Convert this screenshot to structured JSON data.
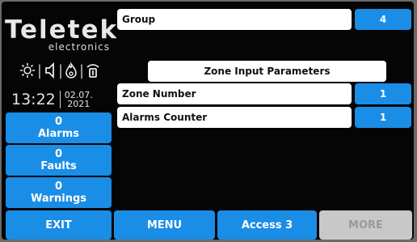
{
  "brand": {
    "name": "Teletek",
    "tagline": "electronics"
  },
  "status_icons": [
    "sun-icon",
    "speaker-icon",
    "flame-icon",
    "wifi-icon"
  ],
  "clock": {
    "time": "13:22",
    "date_day_month": "02.07.",
    "date_year": "2021"
  },
  "status": {
    "alarms": {
      "count": "0",
      "label": "Alarms"
    },
    "faults": {
      "count": "0",
      "label": "Faults"
    },
    "warnings": {
      "count": "0",
      "label": "Warnings"
    }
  },
  "group": {
    "label": "Group",
    "value": "4"
  },
  "section_title": "Zone Input Parameters",
  "params": [
    {
      "label": "Zone Number",
      "value": "1"
    },
    {
      "label": "Alarms Counter",
      "value": "1"
    }
  ],
  "bottom": {
    "exit": "EXIT",
    "menu": "MENU",
    "access": "Access 3",
    "more": "MORE"
  },
  "colors": {
    "accent": "#1a8de6",
    "background": "#050505",
    "disabled": "#c8c8c8"
  }
}
